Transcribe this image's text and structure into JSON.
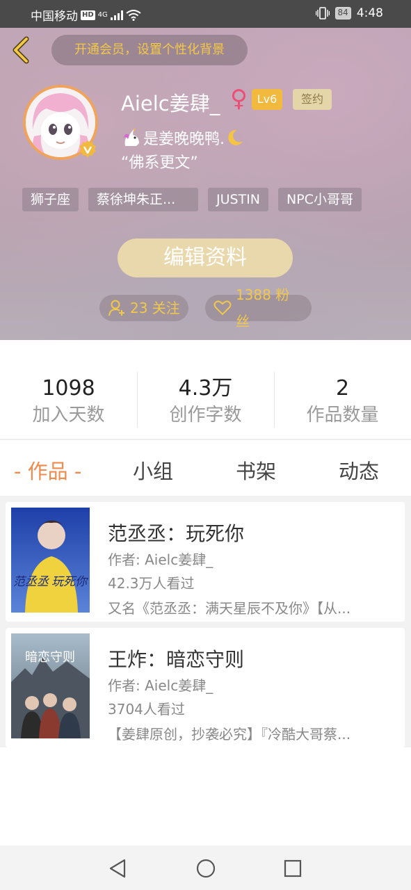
{
  "status_bar": {
    "carrier": "中国移动",
    "hd": "HD",
    "network": "4G",
    "battery": "84",
    "time": "4:48"
  },
  "header": {
    "vip_banner": "开通会员，设置个性化背景",
    "username": "Aielc姜肆_",
    "gender_symbol": "♀",
    "level": "Lv6",
    "signed": "签约",
    "bio_line1": "是姜晚晚鸭.",
    "bio_line2": "“佛系更文”",
    "tags": [
      "狮子座",
      "蔡徐坤朱正...",
      "JUSTIN",
      "NPC小哥哥"
    ],
    "edit_button": "编辑资料",
    "follow": "23 关注",
    "fans": "1388 粉丝"
  },
  "stats": [
    {
      "value": "1098",
      "label": "加入天数"
    },
    {
      "value": "4.3万",
      "label": "创作字数"
    },
    {
      "value": "2",
      "label": "作品数量"
    }
  ],
  "tabs": [
    "- 作品 -",
    "小组",
    "书架",
    "动态"
  ],
  "works": [
    {
      "title": "范丞丞：玩死你",
      "author": "作者: Aielc姜肆_",
      "views": "42.3万人看过",
      "desc": "又名《范丞丞：满天星辰不及你》【从...",
      "cover_text": "范丞丞 玩死你"
    },
    {
      "title": "王炸：暗恋守则",
      "author": "作者: Aielc姜肆_",
      "views": "3704人看过",
      "desc": "【姜肆原创，抄袭必究】『冷酷大哥蔡...",
      "cover_text": "暗恋守则"
    }
  ],
  "colors": {
    "accent": "#f08a4d",
    "gold": "#f1c84a",
    "level_badge": "#f2b93f"
  }
}
